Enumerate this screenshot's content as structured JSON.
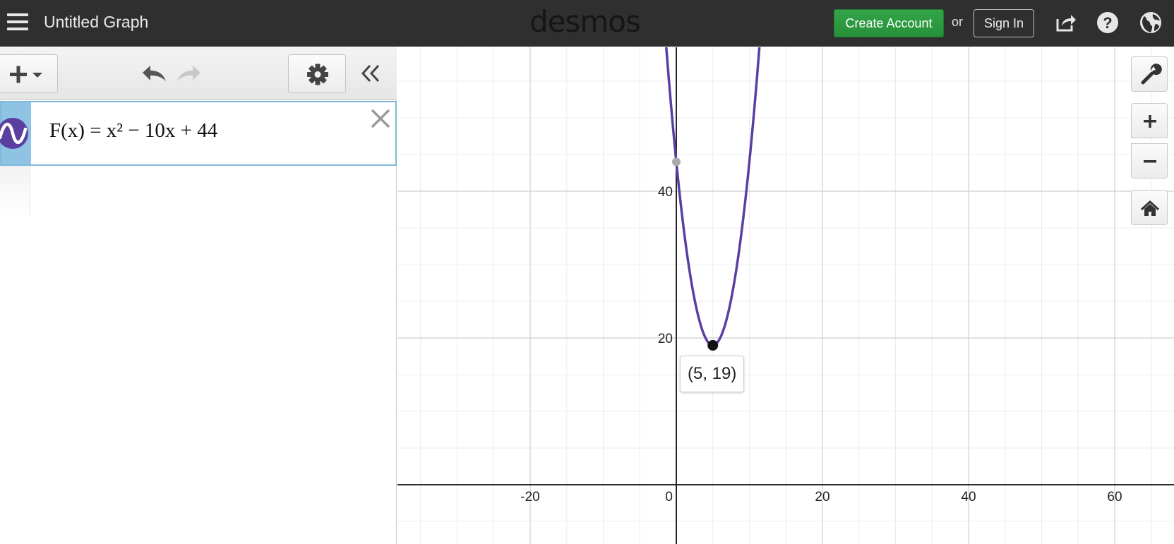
{
  "header": {
    "graph_title": "Untitled Graph",
    "logo": "desmos",
    "create_account_label": "Create Account",
    "or_label": "or",
    "sign_in_label": "Sign In",
    "icons": [
      "menu-icon",
      "share-icon",
      "help-icon",
      "language-globe-icon"
    ]
  },
  "expressions": [
    {
      "index": 1,
      "latex_text": "F(x) = x² − 10x + 44",
      "color": "#5b3fa0",
      "icon": "function-wave-icon"
    }
  ],
  "toolbar": {
    "icons": [
      "add-icon",
      "undo-icon",
      "redo-icon",
      "settings-gear-icon",
      "collapse-icon"
    ]
  },
  "graph": {
    "x_ticks": [
      "-20",
      "0",
      "20",
      "40",
      "60"
    ],
    "y_ticks": [
      "20",
      "40"
    ],
    "curve_color": "#5b3fa0",
    "vertex_point": {
      "x": 5,
      "y": 19,
      "label": "(5, 19)"
    },
    "y_intercept": {
      "x": 0,
      "y": 44
    },
    "side_buttons": [
      "wrench-icon",
      "zoom-in-icon",
      "zoom-out-icon",
      "home-icon"
    ]
  }
}
